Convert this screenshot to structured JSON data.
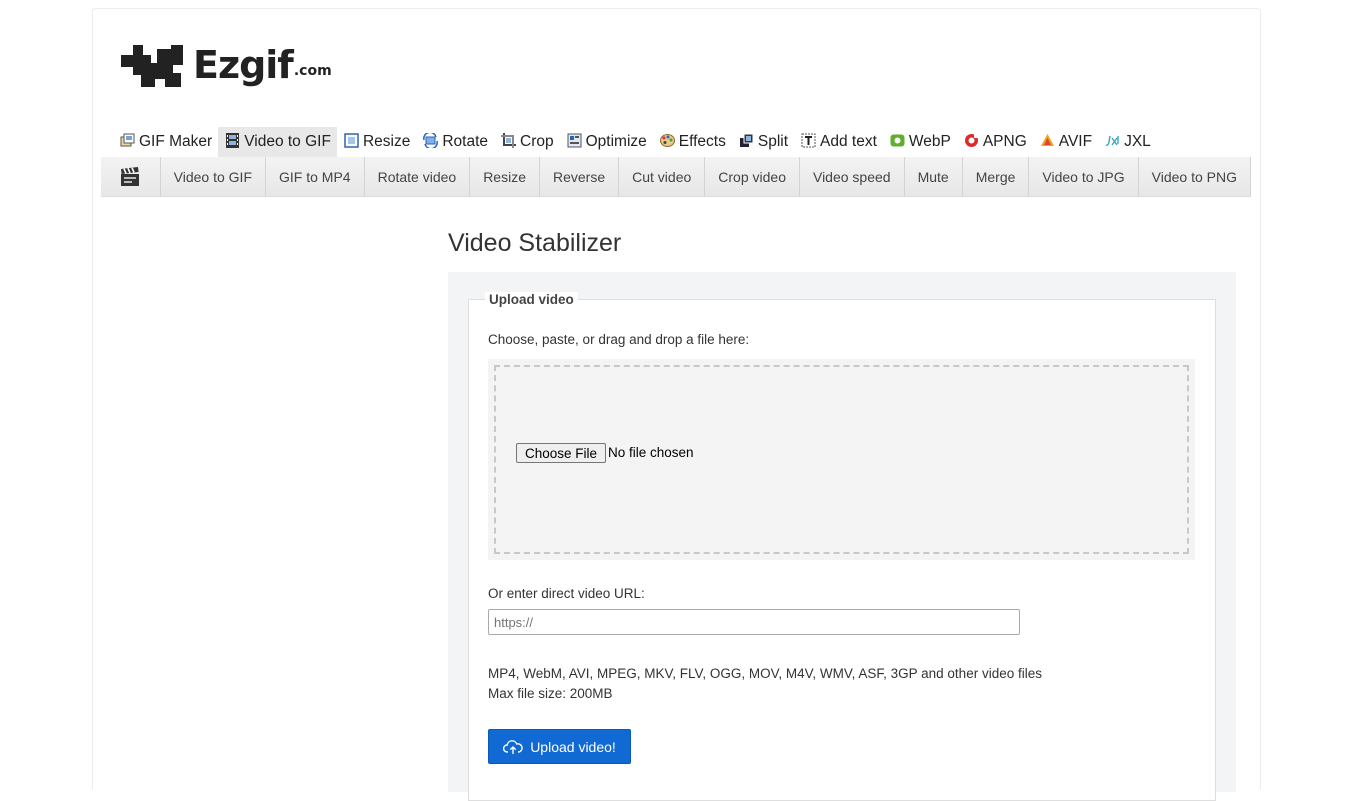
{
  "brand": {
    "word": "Ezgif",
    "suffix": ".com"
  },
  "mainnav": [
    {
      "label": "GIF Maker",
      "icon": "gif-maker-icon",
      "active": false
    },
    {
      "label": "Video to GIF",
      "icon": "film-icon",
      "active": true
    },
    {
      "label": "Resize",
      "icon": "resize-icon",
      "active": false
    },
    {
      "label": "Rotate",
      "icon": "rotate-icon",
      "active": false
    },
    {
      "label": "Crop",
      "icon": "crop-icon",
      "active": false
    },
    {
      "label": "Optimize",
      "icon": "optimize-icon",
      "active": false
    },
    {
      "label": "Effects",
      "icon": "palette-icon",
      "active": false
    },
    {
      "label": "Split",
      "icon": "split-icon",
      "active": false
    },
    {
      "label": "Add text",
      "icon": "text-icon",
      "active": false
    },
    {
      "label": "WebP",
      "icon": "webp-icon",
      "active": false
    },
    {
      "label": "APNG",
      "icon": "apng-icon",
      "active": false
    },
    {
      "label": "AVIF",
      "icon": "avif-icon",
      "active": false
    },
    {
      "label": "JXL",
      "icon": "jxl-icon",
      "active": false
    }
  ],
  "subnav": [
    "Video to GIF",
    "GIF to MP4",
    "Rotate video",
    "Resize",
    "Reverse",
    "Cut video",
    "Crop video",
    "Video speed",
    "Mute",
    "Merge",
    "Video to JPG",
    "Video to PNG"
  ],
  "page_title": "Video Stabilizer",
  "upload": {
    "legend": "Upload video",
    "choose_label": "Choose, paste, or drag and drop a file here:",
    "file_button": "Choose File",
    "file_status": "No file chosen",
    "url_label": "Or enter direct video URL:",
    "url_placeholder": "https://",
    "url_value": "",
    "formats_line": "MP4, WebM, AVI, MPEG, MKV, FLV, OGG, MOV, M4V, WMV, ASF, 3GP and other video files",
    "max_size": "Max file size: 200MB",
    "submit_label": "Upload video!"
  },
  "colors": {
    "accent": "#1169d4",
    "active_tab": "#e8e8e8",
    "panel_bg": "#f3f4f5"
  }
}
